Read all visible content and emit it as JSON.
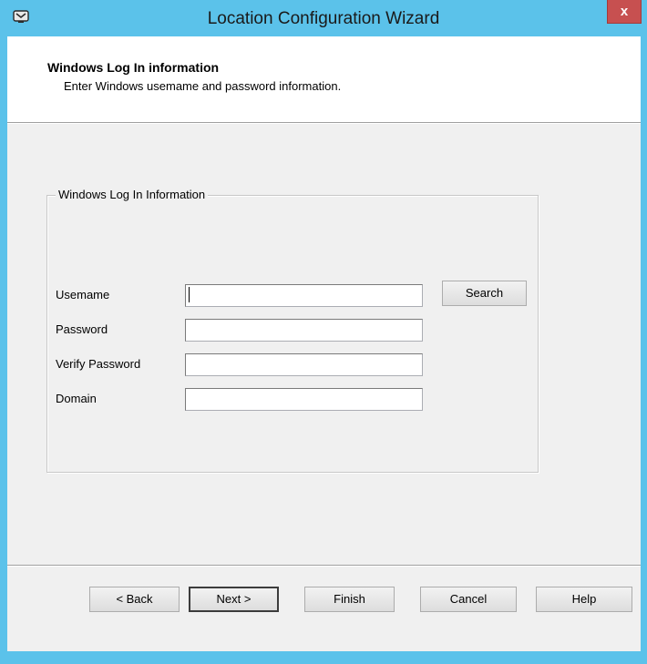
{
  "window": {
    "title": "Location Configuration Wizard",
    "close_label": "x",
    "app_icon": "app-icon",
    "title_bar_color": "#5bc2ea",
    "close_button_color": "#c75050"
  },
  "header": {
    "title": "Windows Log In information",
    "subtitle": "Enter Windows usemame and password information."
  },
  "group": {
    "legend": "Windows Log In Information",
    "fields": {
      "username": {
        "label": "Usemame",
        "value": ""
      },
      "password": {
        "label": "Password",
        "value": ""
      },
      "verify_password": {
        "label": "Verify Password",
        "value": ""
      },
      "domain": {
        "label": "Domain",
        "value": ""
      }
    },
    "search_label": "Search"
  },
  "footer": {
    "back_label": "< Back",
    "next_label": "Next >",
    "finish_label": "Finish",
    "cancel_label": "Cancel",
    "help_label": "Help"
  }
}
